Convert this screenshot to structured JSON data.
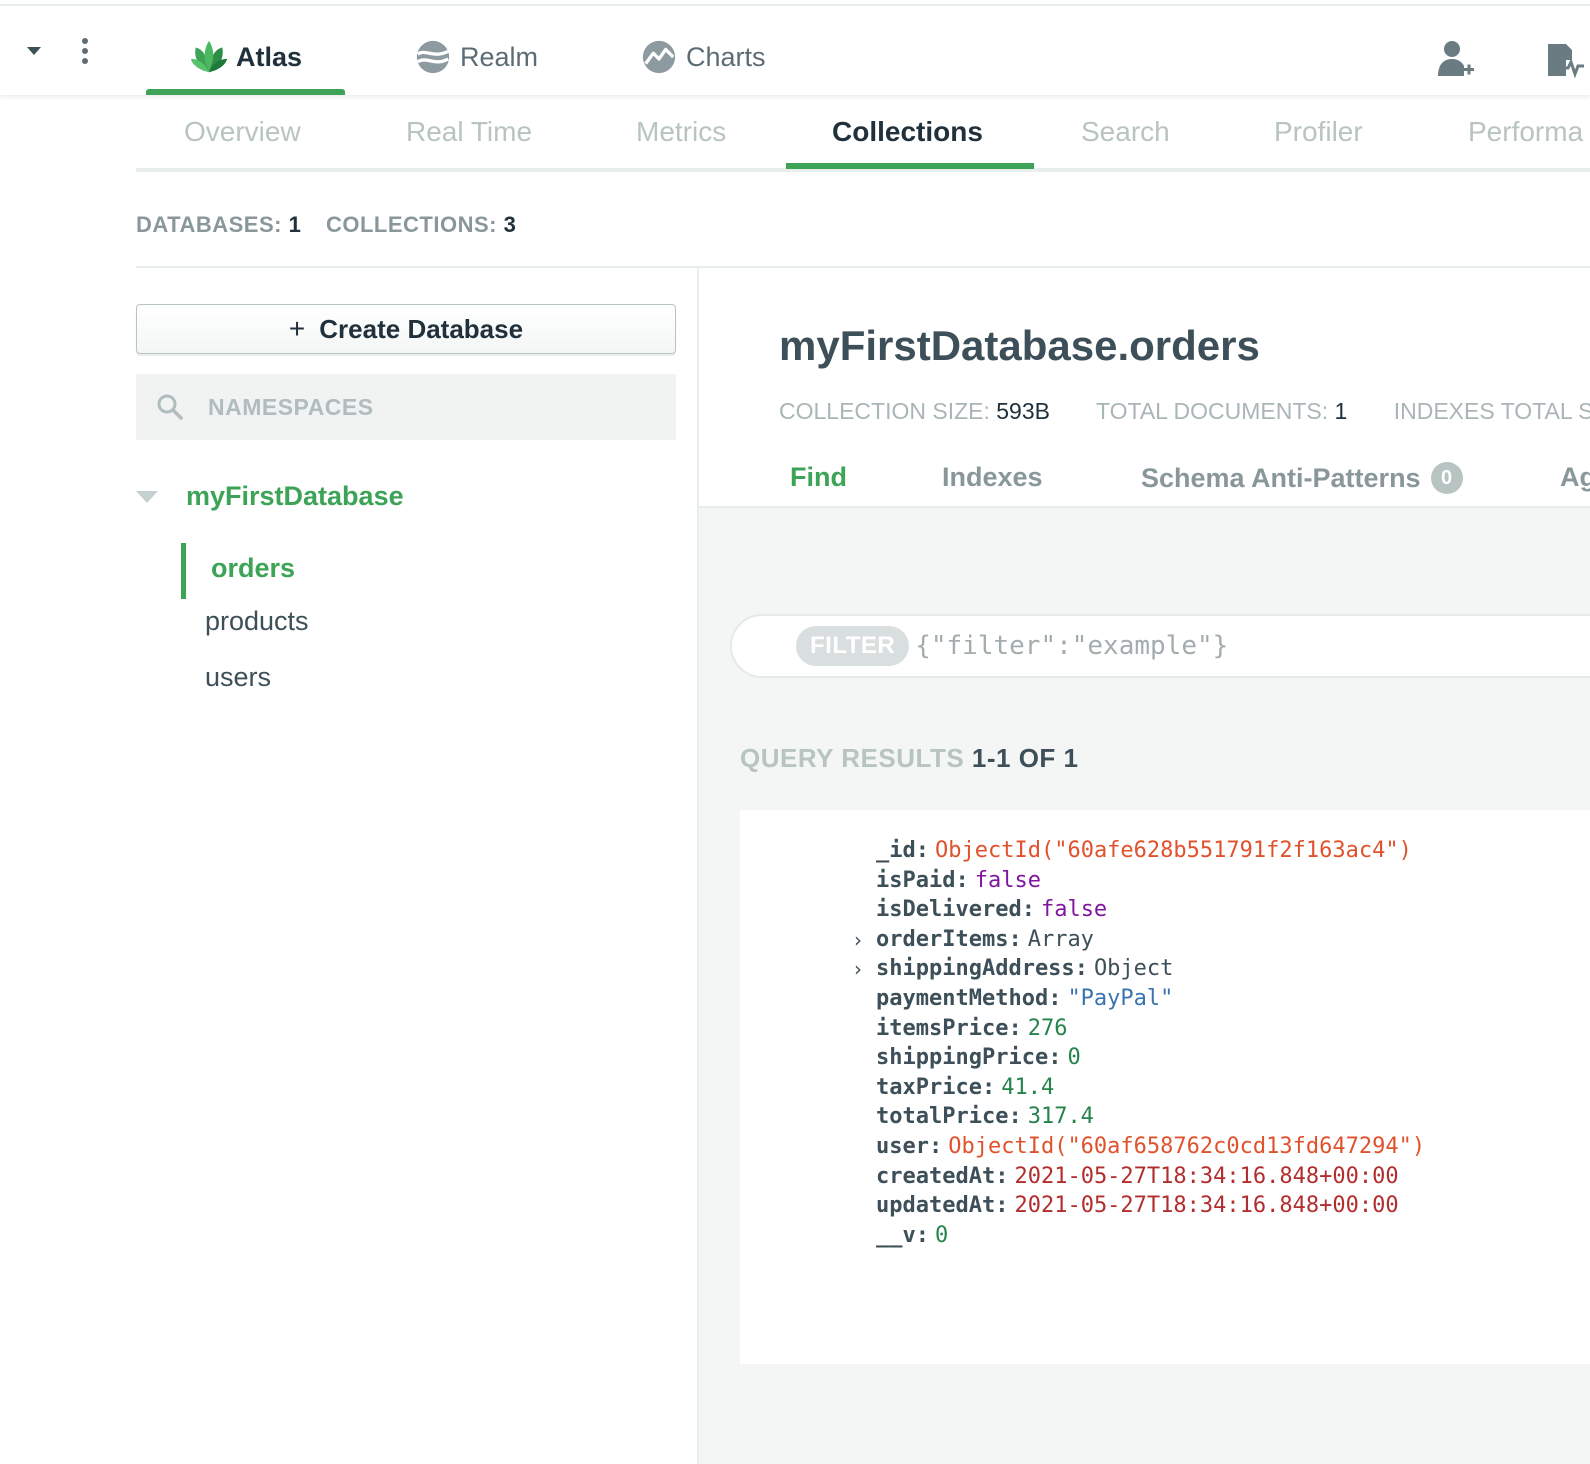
{
  "topnav": {
    "products": [
      {
        "label": "Atlas",
        "icon": "atlas-leaf-icon",
        "active": true
      },
      {
        "label": "Realm",
        "icon": "realm-icon",
        "active": false
      },
      {
        "label": "Charts",
        "icon": "charts-icon",
        "active": false
      }
    ],
    "accent": "#3da356"
  },
  "subnav": {
    "tabs": [
      {
        "label": "Overview"
      },
      {
        "label": "Real Time"
      },
      {
        "label": "Metrics"
      },
      {
        "label": "Collections",
        "active": true
      },
      {
        "label": "Search"
      },
      {
        "label": "Profiler"
      },
      {
        "label": "Performa"
      }
    ]
  },
  "stats": {
    "databases_label": "DATABASES:",
    "databases_value": "1",
    "collections_label": "COLLECTIONS:",
    "collections_value": "3"
  },
  "sidebar": {
    "create_button": {
      "plus": "+",
      "label": "Create Database"
    },
    "search_placeholder": "NAMESPACES",
    "database": "myFirstDatabase",
    "collections": [
      "orders",
      "products",
      "users"
    ],
    "active_collection": "orders"
  },
  "collection": {
    "title": "myFirstDatabase.orders",
    "size_label": "COLLECTION SIZE:",
    "size_value": "593B",
    "docs_label": "TOTAL DOCUMENTS:",
    "docs_value": "1",
    "indexes_label": "INDEXES TOTAL S",
    "tabs": [
      {
        "label": "Find",
        "active": true
      },
      {
        "label": "Indexes"
      },
      {
        "label": "Schema Anti-Patterns",
        "badge": "0"
      },
      {
        "label": "Ag"
      }
    ]
  },
  "filter": {
    "label": "FILTER",
    "placeholder": "{\"filter\":\"example\"}"
  },
  "results": {
    "label": "QUERY RESULTS",
    "range": "1-1 OF 1"
  },
  "document": {
    "fields": [
      {
        "key": "_id",
        "value": "ObjectId(\"60afe628b551791f2f163ac4\")",
        "type": "oid"
      },
      {
        "key": "isPaid",
        "value": "false",
        "type": "bool"
      },
      {
        "key": "isDelivered",
        "value": "false",
        "type": "bool"
      },
      {
        "key": "orderItems",
        "value": "Array",
        "type": "type",
        "expandable": true
      },
      {
        "key": "shippingAddress",
        "value": "Object",
        "type": "type",
        "expandable": true
      },
      {
        "key": "paymentMethod",
        "value": "\"PayPal\"",
        "type": "str"
      },
      {
        "key": "itemsPrice",
        "value": "276",
        "type": "num"
      },
      {
        "key": "shippingPrice",
        "value": "0",
        "type": "num"
      },
      {
        "key": "taxPrice",
        "value": "41.4",
        "type": "num"
      },
      {
        "key": "totalPrice",
        "value": "317.4",
        "type": "num"
      },
      {
        "key": "user",
        "value": "ObjectId(\"60af658762c0cd13fd647294\")",
        "type": "oid"
      },
      {
        "key": "createdAt",
        "value": "2021-05-27T18:34:16.848+00:00",
        "type": "date"
      },
      {
        "key": "updatedAt",
        "value": "2021-05-27T18:34:16.848+00:00",
        "type": "date"
      },
      {
        "key": "__v",
        "value": "0",
        "type": "num"
      }
    ]
  }
}
